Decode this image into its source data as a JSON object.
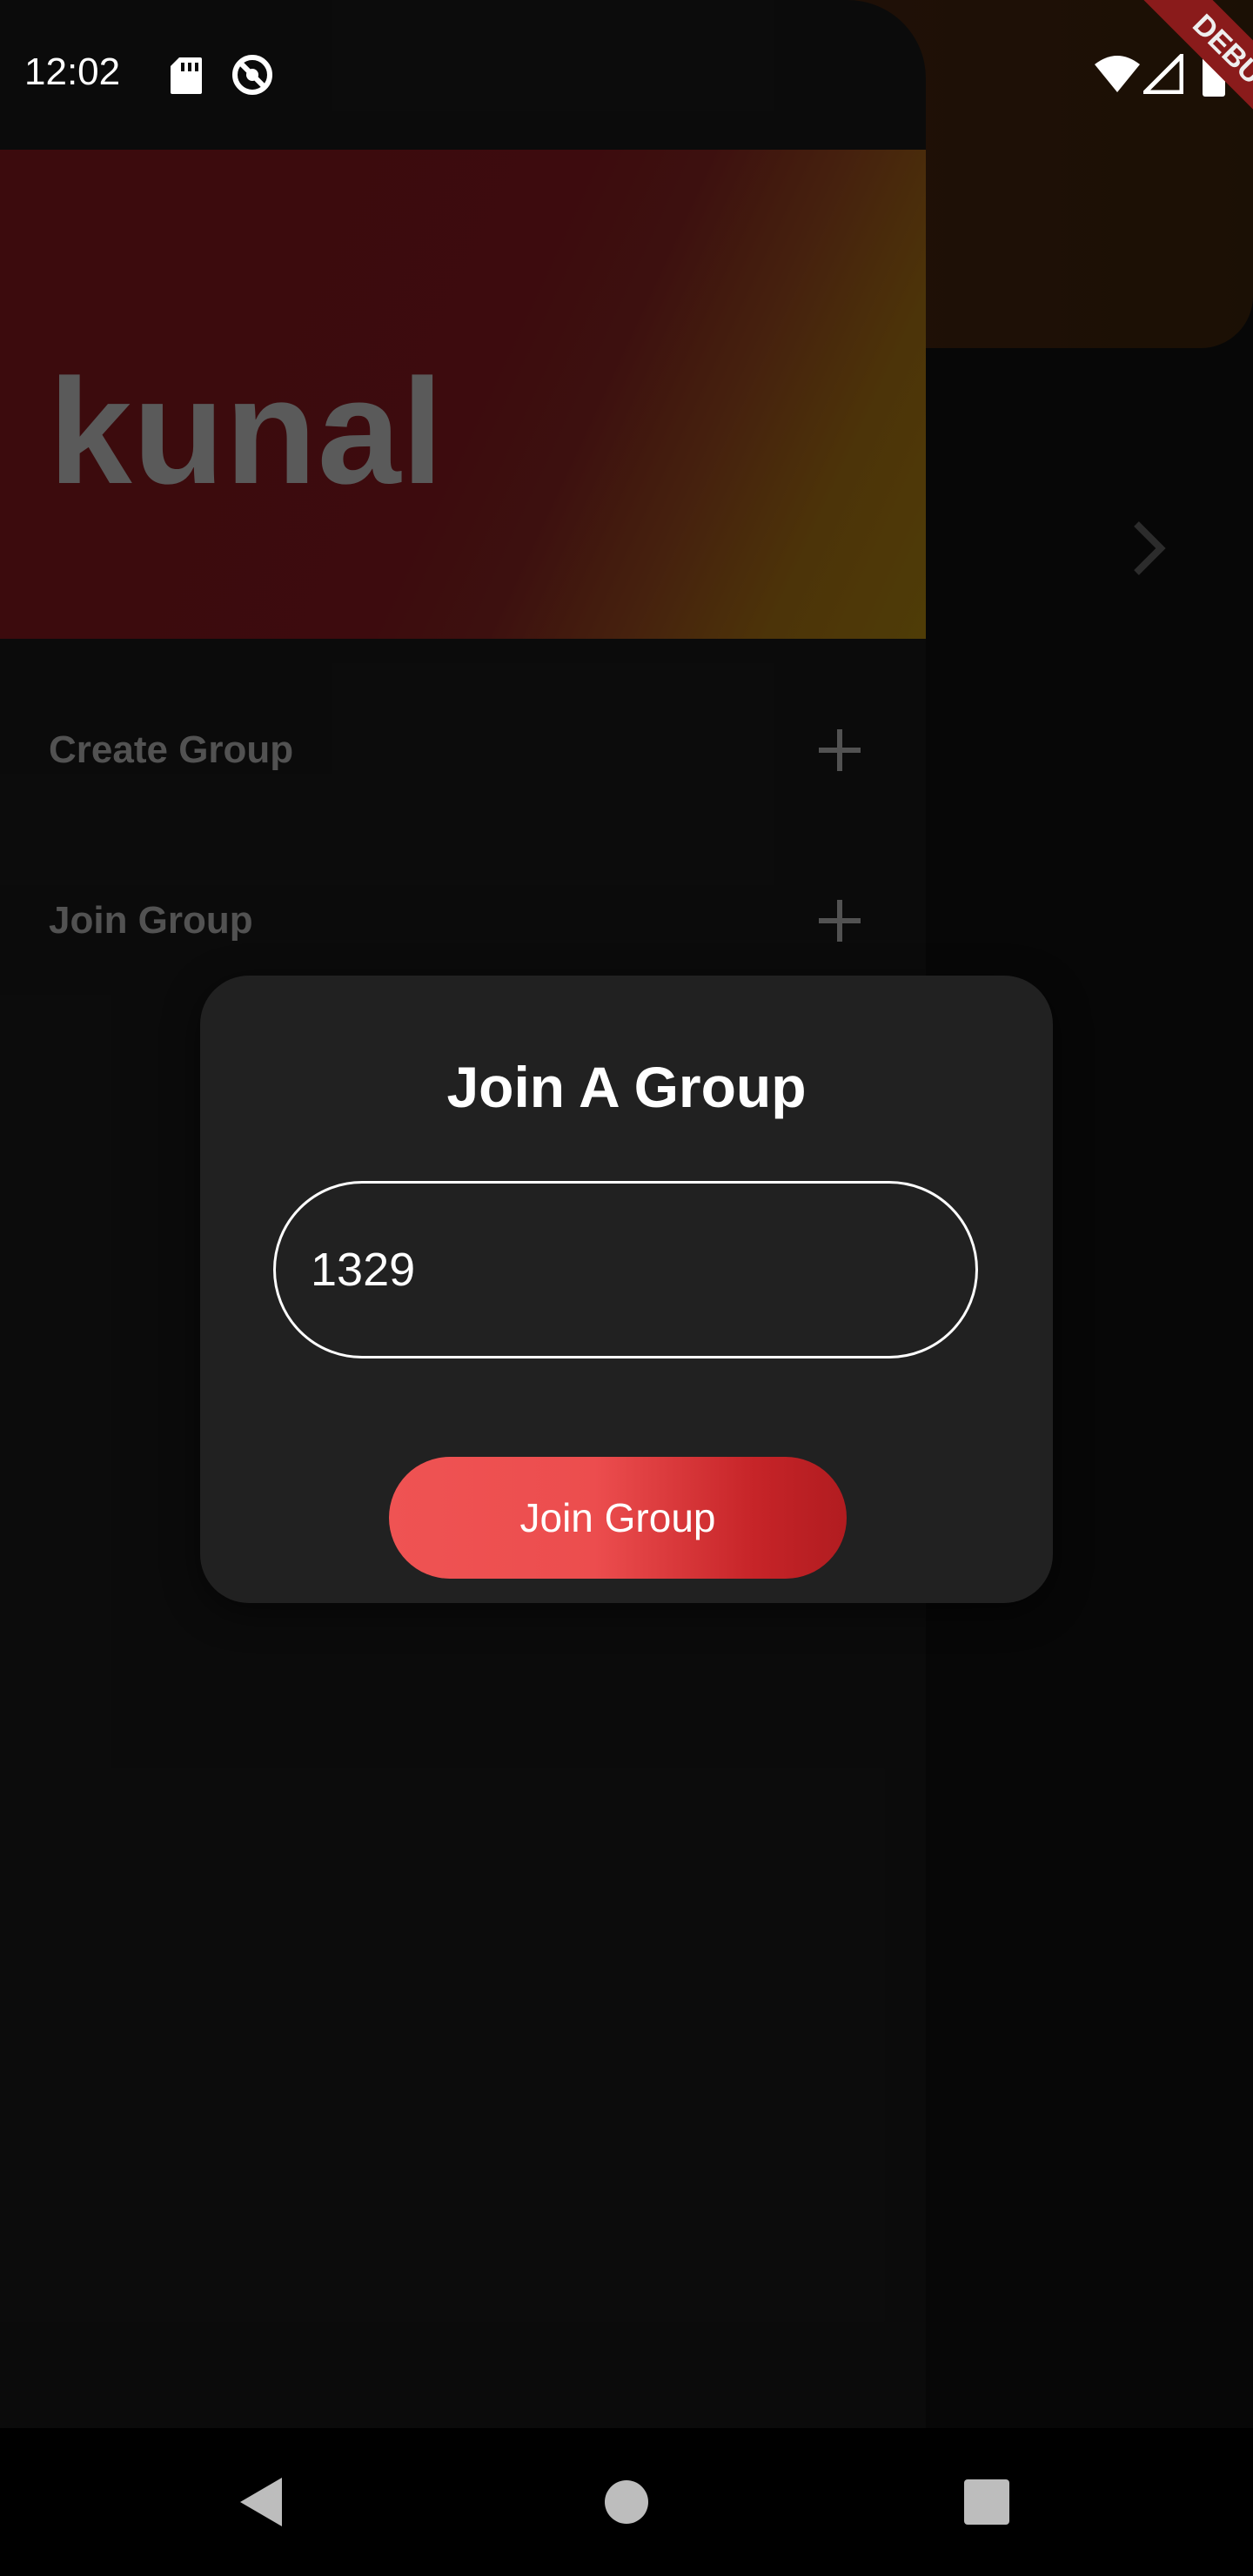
{
  "status_bar": {
    "time": "12:02",
    "debug_banner": "DEBUG",
    "icons": [
      "sd-card-icon",
      "sync-icon",
      "wifi-icon",
      "signal-icon",
      "battery-icon"
    ]
  },
  "drawer": {
    "user_name": "kunal",
    "items": [
      {
        "label": "Create Group",
        "icon": "plus-icon"
      },
      {
        "label": "Join Group",
        "icon": "plus-icon"
      }
    ]
  },
  "dialog": {
    "title": "Join A Group",
    "group_code_value": "1329",
    "join_button_label": "Join Group"
  },
  "nav_bar": {
    "buttons": [
      "back-icon",
      "home-icon",
      "recents-icon"
    ]
  },
  "colors": {
    "dialog_bg": "#212121",
    "button_gradient_start": "#ef5353",
    "button_gradient_end": "#b11c20",
    "drawer_bg": "#121212"
  }
}
